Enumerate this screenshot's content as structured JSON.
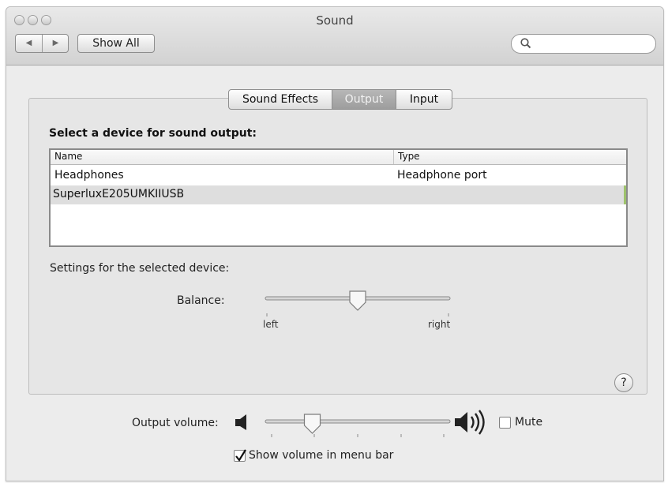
{
  "window": {
    "title": "Sound"
  },
  "toolbar": {
    "back_glyph": "◀",
    "forward_glyph": "▶",
    "show_all": "Show All"
  },
  "search": {
    "placeholder": "",
    "value": "",
    "icon": "search-icon"
  },
  "tabs": [
    {
      "label": "Sound Effects",
      "active": false
    },
    {
      "label": "Output",
      "active": true
    },
    {
      "label": "Input",
      "active": false
    }
  ],
  "output": {
    "heading": "Select a device for sound output:",
    "columns": [
      "Name",
      "Type"
    ],
    "rows": [
      {
        "name": "Headphones",
        "type": "Headphone port",
        "selected": false
      },
      {
        "name": "SuperluxE205UMKIIUSB",
        "type": "",
        "selected": true
      }
    ],
    "settings_label": "Settings for the selected device:",
    "balance": {
      "label": "Balance:",
      "left": "left",
      "right": "right",
      "value": 0.5
    }
  },
  "help": {
    "label": "?"
  },
  "volume": {
    "label": "Output volume:",
    "value": 0.25,
    "mute_label": "Mute",
    "mute_checked": false,
    "show_in_menu_bar_label": "Show volume in menu bar",
    "show_in_menu_bar_checked": true
  },
  "colors": {
    "selected_row": "#dedede",
    "active_tab": "#a9a9a9",
    "row_marker": "#9ec26c"
  }
}
